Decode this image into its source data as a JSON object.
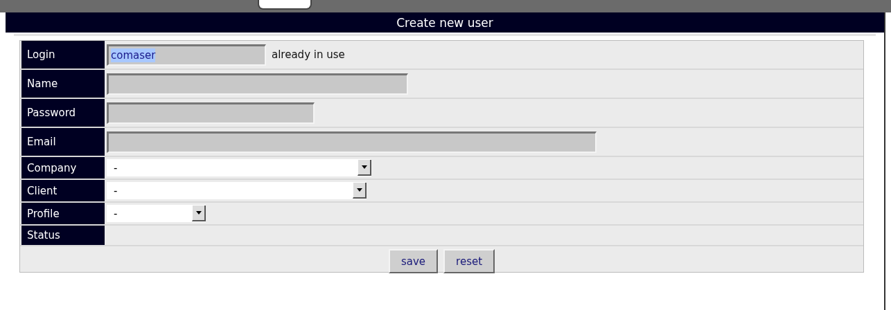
{
  "title": "Create new user",
  "fields": [
    {
      "label": "Login",
      "kind": "text",
      "value": "comaser",
      "highlighted": true,
      "note": "already in use"
    },
    {
      "label": "Name",
      "kind": "text"
    },
    {
      "label": "Password",
      "kind": "text"
    },
    {
      "label": "Email",
      "kind": "text"
    },
    {
      "label": "Company",
      "kind": "select",
      "value": "-"
    },
    {
      "label": "Client",
      "kind": "select",
      "value": "-"
    },
    {
      "label": "Profile",
      "kind": "select",
      "value": "-"
    },
    {
      "label": "Status",
      "kind": "empty"
    }
  ],
  "buttons": [
    "save",
    "reset"
  ]
}
